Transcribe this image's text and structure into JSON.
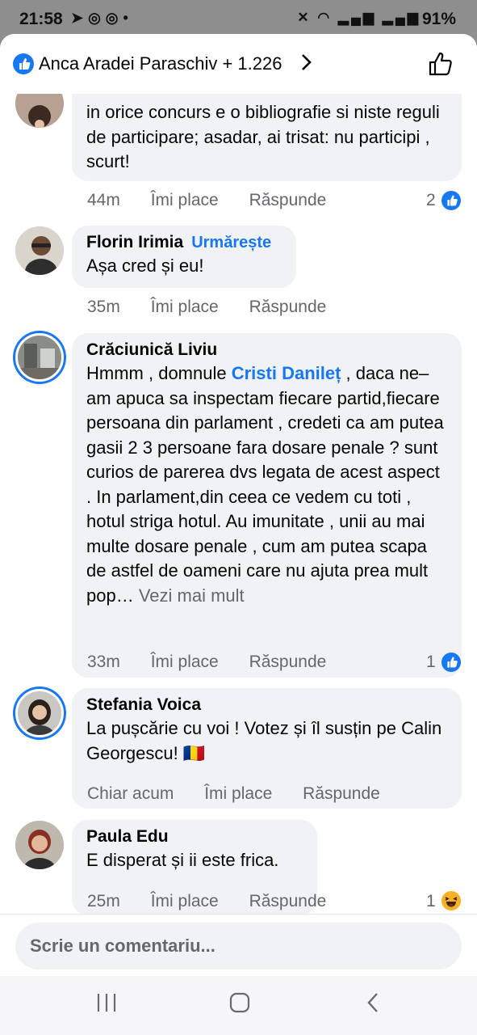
{
  "status_bar": {
    "time": "21:58",
    "battery": "91%"
  },
  "header": {
    "reactors": "Anca Aradei Paraschiv + 1.226"
  },
  "comments": [
    {
      "name": "",
      "text": "in orice concurs e o bibliografie si niste reguli de participare; asadar, ai trisat: nu participi , scurt!",
      "time": "44m",
      "like": "Îmi place",
      "reply": "Răspunde",
      "reactions": "2"
    },
    {
      "name": "Florin Irimia",
      "follow": "Urmărește",
      "text": "Așa cred și eu!",
      "time": "35m",
      "like": "Îmi place",
      "reply": "Răspunde"
    },
    {
      "name": "Crăciunică Liviu",
      "text_before": "Hmmm , domnule ",
      "mention": "Cristi Danileț",
      "text_after": " , daca ne–am apuca sa inspectam fiecare partid,fiecare persoana din parlament , credeti ca am putea gasii 2 3 persoane fara dosare penale ? sunt curios de parerea dvs legata de acest aspect . In parlament,din ceea ce vedem cu toti , hotul striga hotul. Au imunitate , unii au mai multe dosare penale , cum am putea scapa de astfel de oameni care nu ajuta prea mult pop… ",
      "see_more": "Vezi mai mult",
      "time": "33m",
      "like": "Îmi place",
      "reply": "Răspunde",
      "reactions": "1"
    },
    {
      "name": "Stefania Voica",
      "text": "La pușcărie cu voi ! Votez și îl susțin pe Calin Georgescu! 🇷🇴",
      "time": "Chiar acum",
      "like": "Îmi place",
      "reply": "Răspunde"
    },
    {
      "name": "Paula Edu",
      "text": "E disperat și ii este frica.",
      "time": "25m",
      "like": "Îmi place",
      "reply": "Răspunde",
      "reactions": "1"
    }
  ],
  "composer": {
    "placeholder": "Scrie un comentariu..."
  },
  "colors": {
    "accent": "#1877f2",
    "bubble": "#f0f2f5",
    "muted": "#65676b",
    "haha": "#f7b125"
  },
  "icons": [
    "like-badge-icon",
    "chevron-right-icon",
    "thumbs-up-icon",
    "haha-icon",
    "recents-icon",
    "home-icon",
    "back-icon"
  ]
}
